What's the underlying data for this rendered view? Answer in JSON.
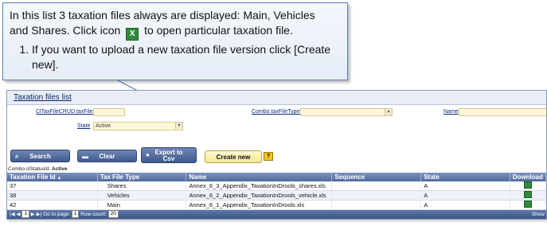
{
  "callout": {
    "line1_before": "In this list 3 taxation files always are displayed: Main, Vehicles",
    "line2_before": "and Shares. Click icon",
    "line2_after": "to open particular taxation file.",
    "step1": "If you want to upload a new taxation file version click [Create new]."
  },
  "panel": {
    "title": "Taxation files list",
    "filters": {
      "id_label": "ClTaxFileCRUD.taxFileId",
      "combo_label": "Combo.taxFileTypeId",
      "name_label": "Name",
      "state_label": "State",
      "state_value": "Active"
    },
    "buttons": {
      "search": "Search",
      "clear": "Clear",
      "export_line1": "Export to",
      "export_line2": "Csv",
      "create_new": "Create new",
      "help": "?"
    },
    "status_label": "Combo.clStatusId:",
    "status_value": "Active",
    "table": {
      "headers": [
        "Taxation File Id",
        "Tax File Type",
        "Name",
        "Sequence",
        "State",
        "Download"
      ],
      "rows": [
        {
          "id": "37",
          "type": "Shares",
          "name": "Annex_6_3_Appendix_TaxationInDrools_shares.xls",
          "sequence": "",
          "state": "A"
        },
        {
          "id": "38",
          "type": "Vehicles",
          "name": "Annex_6_2_Appendix_TaxationInDrools_vehicle.xls",
          "sequence": "",
          "state": "A"
        },
        {
          "id": "42",
          "type": "Main",
          "name": "Annex_6_1_Appendix_TaxationInDrools.xls",
          "sequence": "",
          "state": "A"
        }
      ]
    },
    "pager": {
      "go_to_page": "Go to page:",
      "page": "1",
      "row_count_label": "Row count:",
      "row_count": "20",
      "show": "Show"
    }
  },
  "colors": {
    "header": "#50699c",
    "callout_border": "#5a7fb3",
    "create_button": "#f3e59a"
  }
}
